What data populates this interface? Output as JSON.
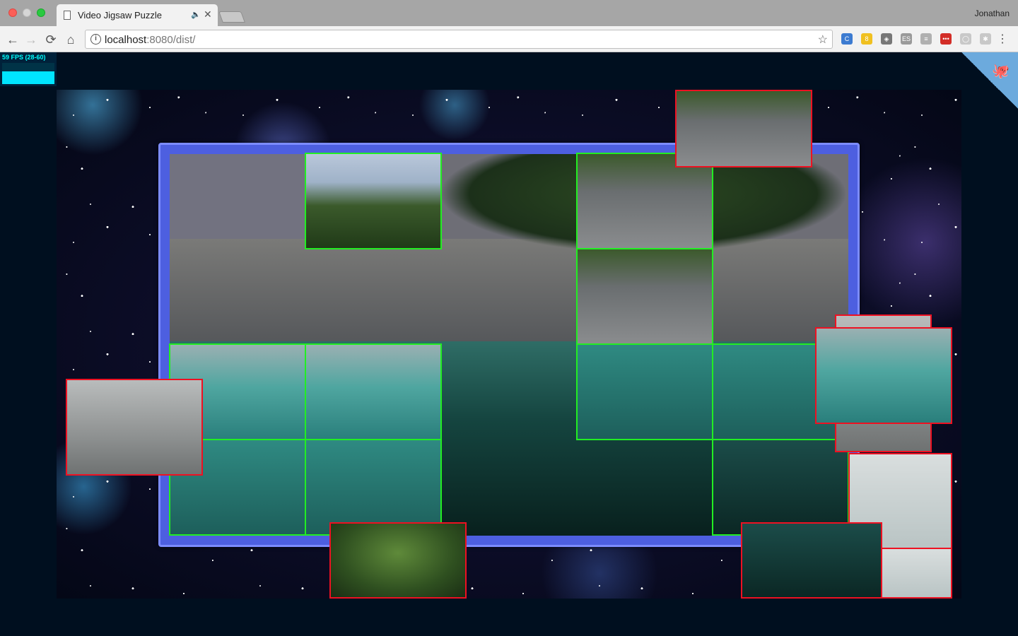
{
  "browser": {
    "tab_title": "Video Jigsaw Puzzle",
    "audio_icon": "🔈",
    "close_icon": "✕",
    "profile_name": "Jonathan",
    "url_host": "localhost",
    "url_rest": ":8080/dist/",
    "back_icon": "←",
    "forward_icon": "→",
    "reload_icon": "⟳",
    "home_icon": "⌂",
    "info_icon": "i",
    "star_icon": "☆",
    "menu_icon": "⋮",
    "extensions": [
      {
        "name": "extension-1-icon",
        "color": "#3c7bd1",
        "label": "C"
      },
      {
        "name": "extension-2-icon",
        "color": "#f0c020",
        "label": "8"
      },
      {
        "name": "shield-extension-icon",
        "color": "#777777",
        "label": "◈"
      },
      {
        "name": "extension-es-icon",
        "color": "#9a9a9a",
        "label": "ES"
      },
      {
        "name": "extension-translate-icon",
        "color": "#b0b0b0",
        "label": "≡"
      },
      {
        "name": "lastpass-icon",
        "color": "#d32d27",
        "label": "•••"
      },
      {
        "name": "extension-circle-icon",
        "color": "#c8c8c8",
        "label": "◯"
      },
      {
        "name": "extension-gear-icon",
        "color": "#c8c8c8",
        "label": "✱"
      }
    ]
  },
  "fps": {
    "label": "59 FPS (28-60)"
  },
  "fork": {
    "icon": "🐙"
  },
  "puzzle": {
    "border_color_placed": "#22ee22",
    "border_color_loose": "#ee1122",
    "frame_color": "#4d5fe0"
  }
}
